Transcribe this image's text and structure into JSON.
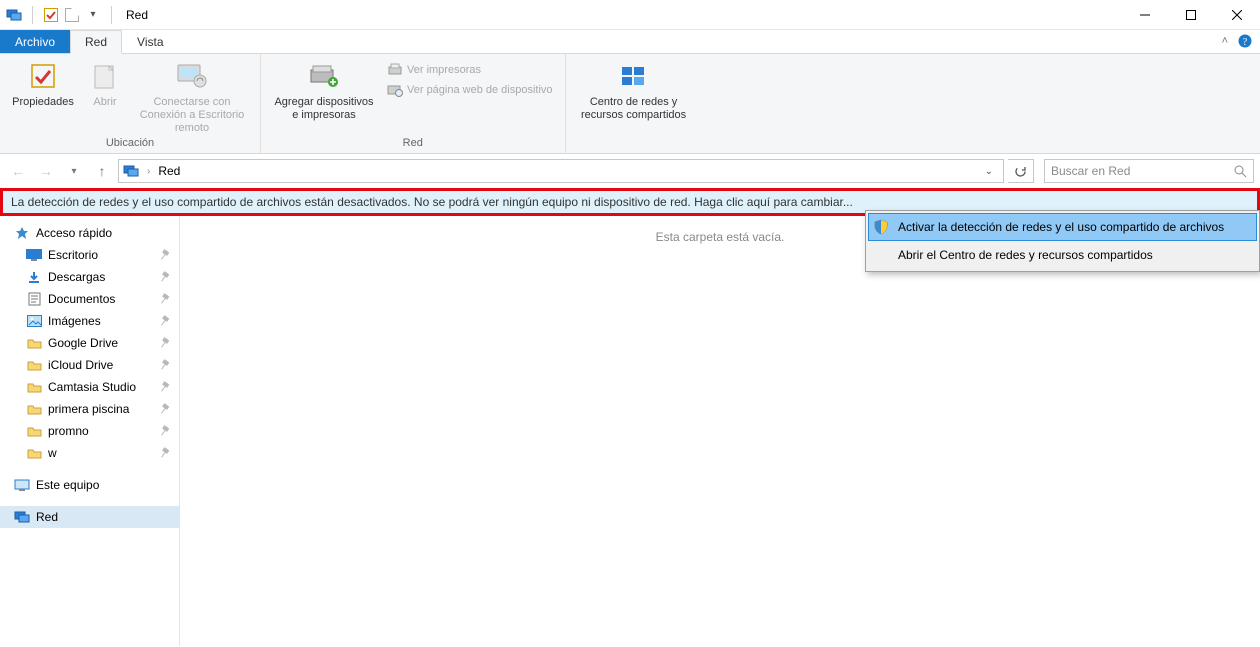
{
  "window": {
    "title": "Red"
  },
  "tabs": {
    "file": "Archivo",
    "current": "Red",
    "view": "Vista"
  },
  "ribbon": {
    "group_location": "Ubicación",
    "group_network": "Red",
    "props": "Propiedades",
    "open": "Abrir",
    "rdp": "Conectarse con Conexión a Escritorio remoto",
    "add_devices": "Agregar dispositivos e impresoras",
    "view_printers": "Ver impresoras",
    "device_webpage": "Ver página web de dispositivo",
    "network_center": "Centro de redes y recursos compartidos"
  },
  "address": {
    "crumb": "Red"
  },
  "search": {
    "placeholder": "Buscar en Red"
  },
  "infobar": {
    "text": "La detección de redes y el uso compartido de archivos están desactivados. No se podrá ver ningún equipo ni dispositivo de red. Haga clic aquí para cambiar..."
  },
  "context_menu": {
    "enable": "Activar la detección de redes y el uso compartido de archivos",
    "open_center": "Abrir el Centro de redes y recursos compartidos"
  },
  "tree": {
    "quick_access": "Acceso rápido",
    "items": [
      "Escritorio",
      "Descargas",
      "Documentos",
      "Imágenes",
      "Google Drive",
      "iCloud Drive",
      "Camtasia Studio",
      "primera piscina",
      "promno",
      "w"
    ],
    "this_pc": "Este equipo",
    "network": "Red"
  },
  "main": {
    "empty": "Esta carpeta está vacía."
  }
}
